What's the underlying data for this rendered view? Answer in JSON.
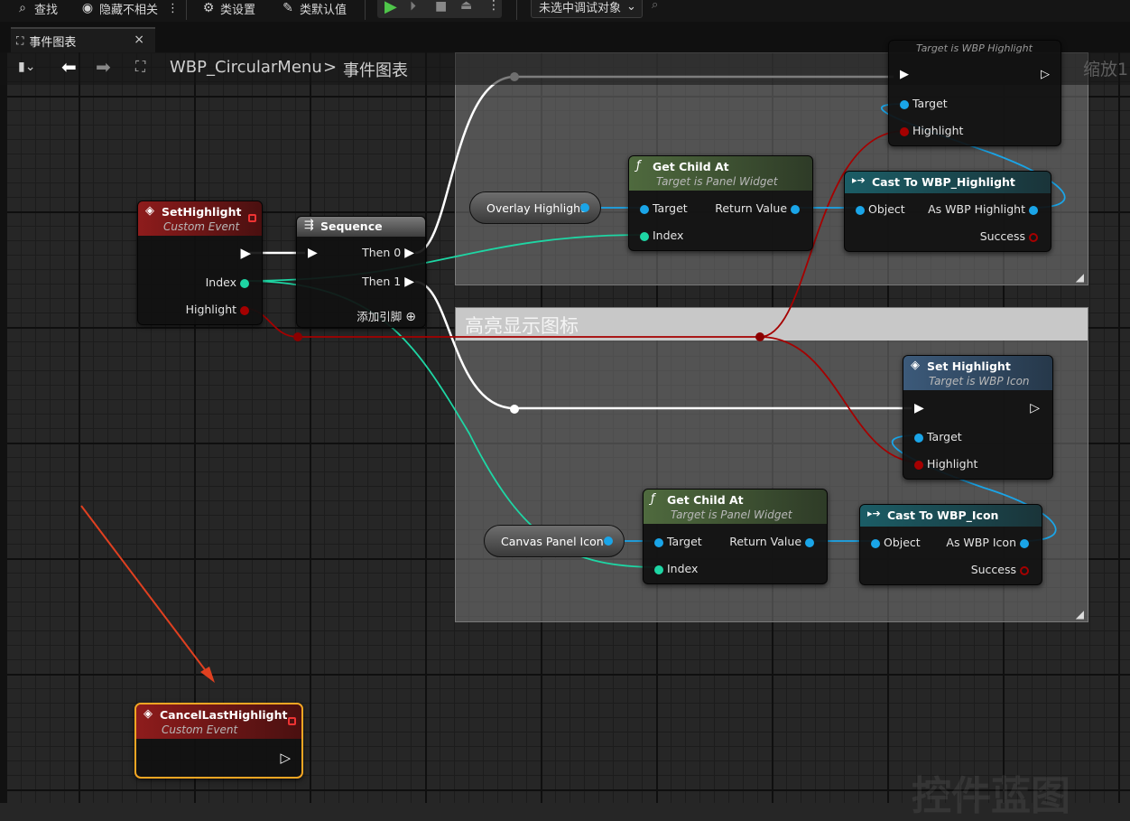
{
  "toolbar": {
    "find": "查找",
    "hide_unrelated": "隐藏不相关",
    "class_settings": "类设置",
    "class_defaults": "类默认值",
    "debug_object": "未选中调试对象"
  },
  "tab": {
    "label": "事件图表",
    "close": "×"
  },
  "breadcrumb": {
    "blueprint": "WBP_CircularMenu",
    "separator": ">",
    "graph": "事件图表"
  },
  "zoom_label": "缩放1",
  "comments": {
    "lower_title": "高亮显示图标"
  },
  "nodes": {
    "set_highlight_event": {
      "title": "SetHighlight",
      "subtitle": "Custom Event",
      "pins": [
        "Index",
        "Highlight"
      ]
    },
    "sequence": {
      "title": "Sequence",
      "pins": [
        "Then 0",
        "Then 1"
      ],
      "add_pin": "添加引脚"
    },
    "overlay_var": {
      "label": "Overlay Highlight"
    },
    "canvas_var": {
      "label": "Canvas Panel Icon"
    },
    "get_child_1": {
      "title": "Get Child At",
      "subtitle": "Target is Panel Widget",
      "pins": [
        "Target",
        "Index",
        "Return Value"
      ]
    },
    "get_child_2": {
      "title": "Get Child At",
      "subtitle": "Target is Panel Widget",
      "pins": [
        "Target",
        "Index",
        "Return Value"
      ]
    },
    "cast_highlight": {
      "title": "Cast To WBP_Highlight",
      "pins": [
        "Object",
        "As WBP Highlight",
        "Success"
      ]
    },
    "cast_icon": {
      "title": "Cast To WBP_Icon",
      "pins": [
        "Object",
        "As WBP Icon",
        "Success"
      ]
    },
    "top_set_highlight": {
      "subtitle": "Target is WBP Highlight",
      "pins": [
        "Target",
        "Highlight"
      ]
    },
    "set_highlight_icon": {
      "title": "Set Highlight",
      "subtitle": "Target is WBP Icon",
      "pins": [
        "Target",
        "Highlight"
      ]
    },
    "cancel_event": {
      "title": "CancelLastHighlight",
      "subtitle": "Custom Event"
    }
  },
  "watermark": "控件蓝图",
  "colors": {
    "exec": "#ffffff",
    "int_pin": "#1ed6a4",
    "bool_pin": "#a50000",
    "object_pin": "#1aa5e8",
    "selection": "#f5a623",
    "arrow": "#e04020"
  }
}
